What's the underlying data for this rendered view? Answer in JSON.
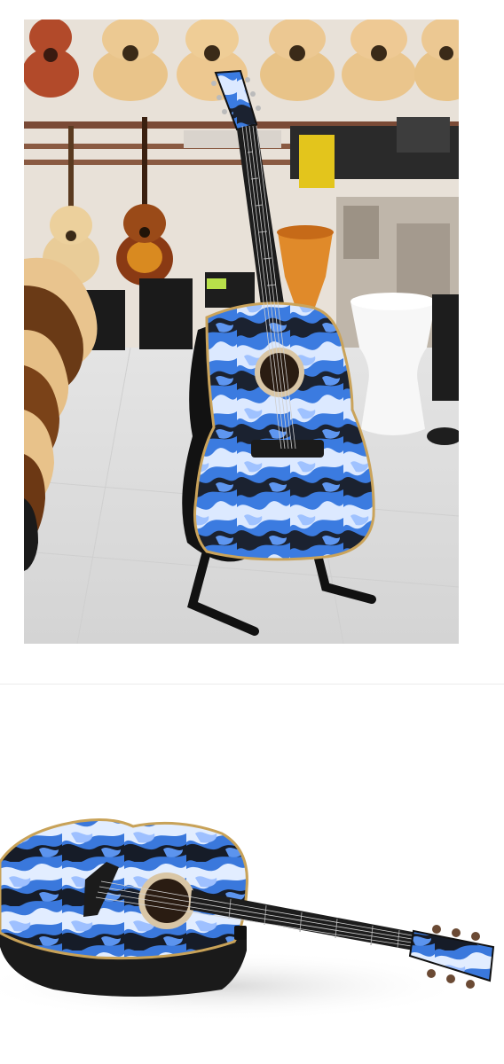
{
  "photos": [
    {
      "name": "guitar-store-photo",
      "description_icon": "photo-icon"
    },
    {
      "name": "guitar-lying-photo",
      "description_icon": "photo-icon"
    }
  ],
  "colors": {
    "background": "#ffffff",
    "divider": "#ececec",
    "wall": "#e9e4df",
    "floor": "#dcdcdc",
    "guitar_blue": "#2f6fd6",
    "guitar_light": "#cfe2ff",
    "guitar_dark": "#1a1f2b",
    "wood": "#e6c28c"
  }
}
